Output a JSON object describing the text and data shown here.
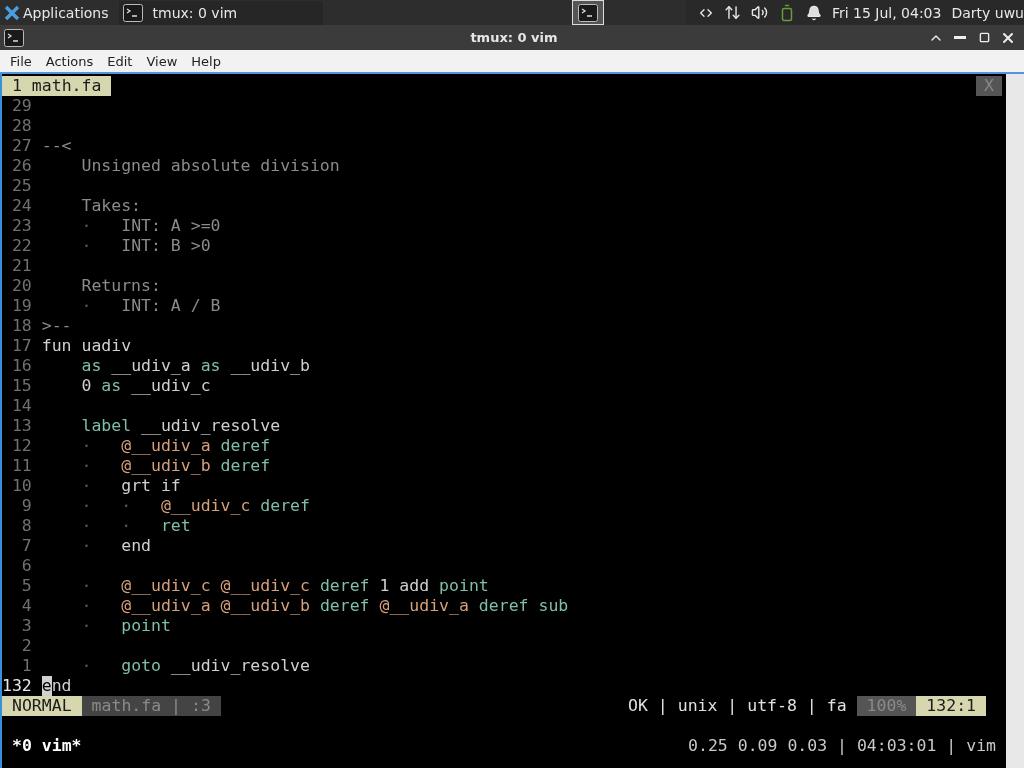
{
  "panel": {
    "launcher": "Applications",
    "tasks": [
      {
        "label": "tmux: 0 vim"
      }
    ],
    "clock": "Fri 15 Jul, 04:03",
    "user": "Darty uwu"
  },
  "window": {
    "title": "tmux: 0 vim"
  },
  "menu": [
    "File",
    "Actions",
    "Edit",
    "View",
    "Help"
  ],
  "tabline": {
    "tabs": [
      {
        "label": "1 math.fa",
        "selected": true
      }
    ],
    "close": "X"
  },
  "lines": [
    {
      "number": "29",
      "current": false
    },
    {
      "number": "28",
      "current": false
    },
    {
      "number": "27",
      "current": false,
      "tokens": [
        {
          "text": "--<",
          "kind": "comment"
        }
      ]
    },
    {
      "number": "26",
      "current": false,
      "tokens": [
        {
          "text": "    Unsigned absolute division",
          "kind": "comment"
        }
      ]
    },
    {
      "number": "25",
      "current": false
    },
    {
      "number": "24",
      "current": false,
      "tokens": [
        {
          "text": "    Takes:",
          "kind": "comment"
        }
      ]
    },
    {
      "number": "23",
      "current": false,
      "tokens": [
        {
          "text": "    ·   ",
          "kind": "guide"
        },
        {
          "text": "INT: A >=0",
          "kind": "comment"
        }
      ]
    },
    {
      "number": "22",
      "current": false,
      "tokens": [
        {
          "text": "    ·   ",
          "kind": "guide"
        },
        {
          "text": "INT: B >0",
          "kind": "comment"
        }
      ]
    },
    {
      "number": "21",
      "current": false
    },
    {
      "number": "20",
      "current": false,
      "tokens": [
        {
          "text": "    Returns:",
          "kind": "comment"
        }
      ]
    },
    {
      "number": "19",
      "current": false,
      "tokens": [
        {
          "text": "    ·   ",
          "kind": "guide"
        },
        {
          "text": "INT: A / B",
          "kind": "comment"
        }
      ]
    },
    {
      "number": "18",
      "current": false,
      "tokens": [
        {
          "text": ">--",
          "kind": "comment"
        }
      ]
    },
    {
      "number": "17",
      "current": false,
      "tokens": [
        {
          "text": "fun uadiv",
          "kind": "plain"
        }
      ]
    },
    {
      "number": "16",
      "current": false,
      "tokens": [
        {
          "text": "    as",
          "kind": "keyword"
        },
        {
          "text": " __udiv_a ",
          "kind": "plain"
        },
        {
          "text": "as",
          "kind": "keyword"
        },
        {
          "text": " __udiv_b",
          "kind": "plain"
        }
      ]
    },
    {
      "number": "15",
      "current": false,
      "tokens": [
        {
          "text": "    0 ",
          "kind": "plain"
        },
        {
          "text": "as",
          "kind": "keyword"
        },
        {
          "text": " __udiv_c",
          "kind": "plain"
        }
      ]
    },
    {
      "number": "14",
      "current": false
    },
    {
      "number": "13",
      "current": false,
      "tokens": [
        {
          "text": "    label",
          "kind": "keyword"
        },
        {
          "text": " __udiv_resolve",
          "kind": "plain"
        }
      ]
    },
    {
      "number": "12",
      "current": false,
      "tokens": [
        {
          "text": "    ·   ",
          "kind": "guide"
        },
        {
          "text": "@__udiv_a",
          "kind": "var"
        },
        {
          "text": " deref",
          "kind": "keyword"
        }
      ]
    },
    {
      "number": "11",
      "current": false,
      "tokens": [
        {
          "text": "    ·   ",
          "kind": "guide"
        },
        {
          "text": "@__udiv_b",
          "kind": "var"
        },
        {
          "text": " deref",
          "kind": "keyword"
        }
      ]
    },
    {
      "number": "10",
      "current": false,
      "tokens": [
        {
          "text": "    ·   ",
          "kind": "guide"
        },
        {
          "text": "grt if",
          "kind": "plain"
        }
      ]
    },
    {
      "number": "9",
      "current": false,
      "tokens": [
        {
          "text": "    ·   ·   ",
          "kind": "guide"
        },
        {
          "text": "@__udiv_c",
          "kind": "var"
        },
        {
          "text": " deref",
          "kind": "keyword"
        }
      ]
    },
    {
      "number": "8",
      "current": false,
      "tokens": [
        {
          "text": "    ·   ·   ",
          "kind": "guide"
        },
        {
          "text": "ret",
          "kind": "keyword"
        }
      ]
    },
    {
      "number": "7",
      "current": false,
      "tokens": [
        {
          "text": "    ·   ",
          "kind": "guide"
        },
        {
          "text": "end",
          "kind": "plain"
        }
      ]
    },
    {
      "number": "6",
      "current": false
    },
    {
      "number": "5",
      "current": false,
      "tokens": [
        {
          "text": "    ·   ",
          "kind": "guide"
        },
        {
          "text": "@__udiv_c @__udiv_c",
          "kind": "var"
        },
        {
          "text": " deref ",
          "kind": "keyword"
        },
        {
          "text": "1 add ",
          "kind": "plain"
        },
        {
          "text": "point",
          "kind": "keyword"
        }
      ]
    },
    {
      "number": "4",
      "current": false,
      "tokens": [
        {
          "text": "    ·   ",
          "kind": "guide"
        },
        {
          "text": "@__udiv_a @__udiv_b",
          "kind": "var"
        },
        {
          "text": " deref ",
          "kind": "keyword"
        },
        {
          "text": "@__udiv_a",
          "kind": "var"
        },
        {
          "text": " deref sub",
          "kind": "keyword"
        }
      ]
    },
    {
      "number": "3",
      "current": false,
      "tokens": [
        {
          "text": "    ·   ",
          "kind": "guide"
        },
        {
          "text": "point",
          "kind": "keyword"
        }
      ]
    },
    {
      "number": "2",
      "current": false
    },
    {
      "number": "1",
      "current": false,
      "tokens": [
        {
          "text": "    ·   ",
          "kind": "guide"
        },
        {
          "text": "goto",
          "kind": "keyword"
        },
        {
          "text": " __udiv_resolve",
          "kind": "plain"
        }
      ]
    },
    {
      "number": "132",
      "current": true,
      "tokens": [
        {
          "text": "e",
          "kind": "cursor"
        },
        {
          "text": "nd",
          "kind": "plain"
        }
      ]
    }
  ],
  "statusline": {
    "mode": "NORMAL",
    "file": "math.fa | :3",
    "info": "OK | unix | utf-8 | fa",
    "percent": "100%",
    "position": "132:1"
  },
  "tmux": {
    "window": "*0 vim*",
    "info": "0.25 0.09 0.03 | 04:03:01 | vim"
  }
}
